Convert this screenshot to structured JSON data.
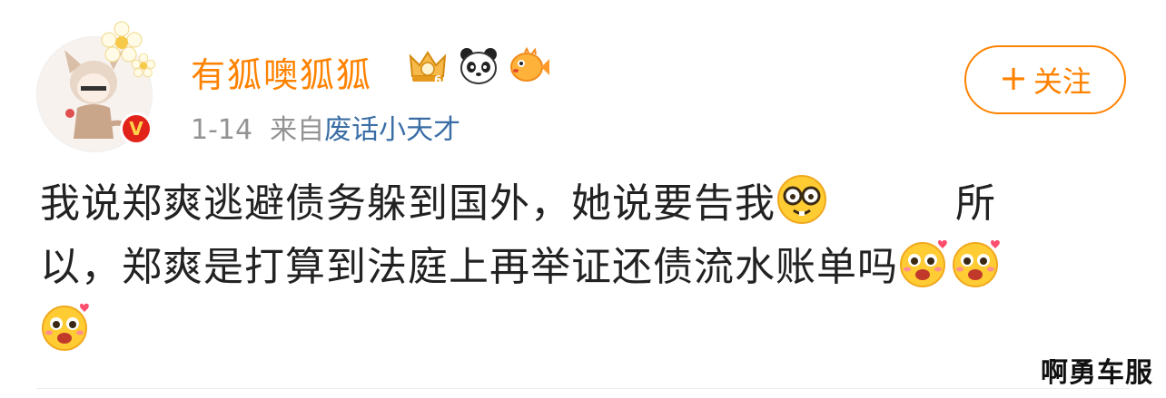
{
  "user": {
    "name": "有狐噢狐狐",
    "verified_badge_glyph": "V",
    "badges": [
      "crown-level-6-badge",
      "panda-badge",
      "pufferfish-badge"
    ]
  },
  "meta": {
    "date": "1-14",
    "source_prefix": "来自",
    "source_name": "废话小天才"
  },
  "follow_button": {
    "plus": "+",
    "label": "关注"
  },
  "post": {
    "line1_text": "我说郑爽逃避债务躲到国外，她说要告我",
    "line1_tail": "所",
    "line2_text": "以，郑爽是打算到法庭上再举证还债流水账单吗",
    "emojis": [
      "nerd-glasses-emoji",
      "happy-hearts-emoji",
      "happy-hearts-emoji",
      "happy-hearts-emoji"
    ]
  },
  "watermark": "啊勇车服",
  "colors": {
    "accent": "#ff8200",
    "link": "#3a6ea5",
    "text": "#222222",
    "meta": "#939393",
    "verify": "#e2231a"
  }
}
